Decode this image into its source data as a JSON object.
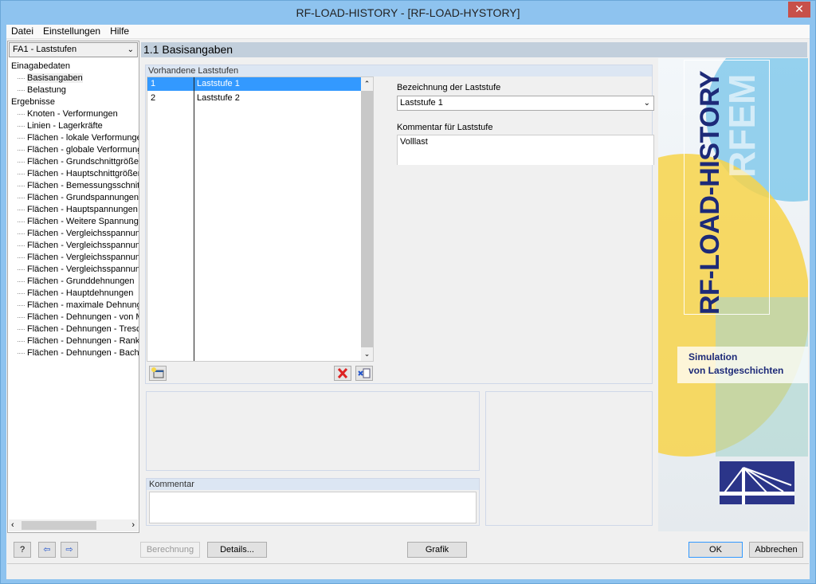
{
  "window": {
    "title": "RF-LOAD-HISTORY - [RF-LOAD-HYSTORY]",
    "close_icon": "close-icon"
  },
  "menu": [
    "Datei",
    "Einstellungen",
    "Hilfe"
  ],
  "nav": {
    "dropdown": "FA1 - Laststufen",
    "tree": [
      {
        "label": "Einagabedaten",
        "level": 0
      },
      {
        "label": "Basisangaben",
        "level": 1,
        "selected": true
      },
      {
        "label": "Belastung",
        "level": 1
      },
      {
        "label": "Ergebnisse",
        "level": 0
      },
      {
        "label": "Knoten - Verformungen",
        "level": 1
      },
      {
        "label": "Linien - Lagerkräfte",
        "level": 1
      },
      {
        "label": "Flächen - lokale Verformungen",
        "level": 1
      },
      {
        "label": "Flächen - globale Verformungen",
        "level": 1
      },
      {
        "label": "Flächen - Grundschnittgrößen",
        "level": 1
      },
      {
        "label": "Flächen - Hauptschnittgrößen",
        "level": 1
      },
      {
        "label": "Flächen - Bemessungsschnittgr",
        "level": 1
      },
      {
        "label": "Flächen - Grundspannungen",
        "level": 1
      },
      {
        "label": "Flächen - Hauptspannungen",
        "level": 1
      },
      {
        "label": "Flächen - Weitere Spannungen",
        "level": 1
      },
      {
        "label": "Flächen - Vergleichsspannunge",
        "level": 1
      },
      {
        "label": "Flächen - Vergleichsspannunge",
        "level": 1
      },
      {
        "label": "Flächen - Vergleichsspannunge",
        "level": 1
      },
      {
        "label": "Flächen - Vergleichsspannunge",
        "level": 1
      },
      {
        "label": "Flächen - Grunddehnungen",
        "level": 1
      },
      {
        "label": "Flächen - Hauptdehnungen",
        "level": 1
      },
      {
        "label": "Flächen - maximale Dehnungen",
        "level": 1
      },
      {
        "label": "Flächen - Dehnungen - von Mis",
        "level": 1
      },
      {
        "label": "Flächen - Dehnungen - Tresca",
        "level": 1
      },
      {
        "label": "Flächen - Dehnungen - Rankine",
        "level": 1
      },
      {
        "label": "Flächen - Dehnungen - Bach",
        "level": 1
      }
    ]
  },
  "main": {
    "header": "1.1 Basisangaben",
    "group_title": "Vorhandene Laststufen",
    "rows": [
      {
        "no": "1",
        "name": "Laststufe 1",
        "selected": true
      },
      {
        "no": "2",
        "name": "Laststufe 2"
      }
    ],
    "bezeichnung_label": "Bezeichnung der Laststufe",
    "bezeichnung_value": "Laststufe 1",
    "kommentar_ls_label": "Kommentar für Laststufe",
    "kommentar_ls_value": "Volllast",
    "kommentar_label": "Kommentar",
    "kommentar_value": ""
  },
  "brand": {
    "product": "RF-LOAD-HISTORY",
    "watermark": "RFEM",
    "tagline1": "Simulation",
    "tagline2": "von Lastgeschichten"
  },
  "footer": {
    "berechnung": "Berechnung",
    "details": "Details...",
    "grafik": "Grafik",
    "ok": "OK",
    "abbrechen": "Abbrechen"
  },
  "colors": {
    "selection": "#3399ff",
    "window_frame": "#8ec3ef",
    "header": "#c2cfdc",
    "brand_navy": "#1d2a78"
  }
}
